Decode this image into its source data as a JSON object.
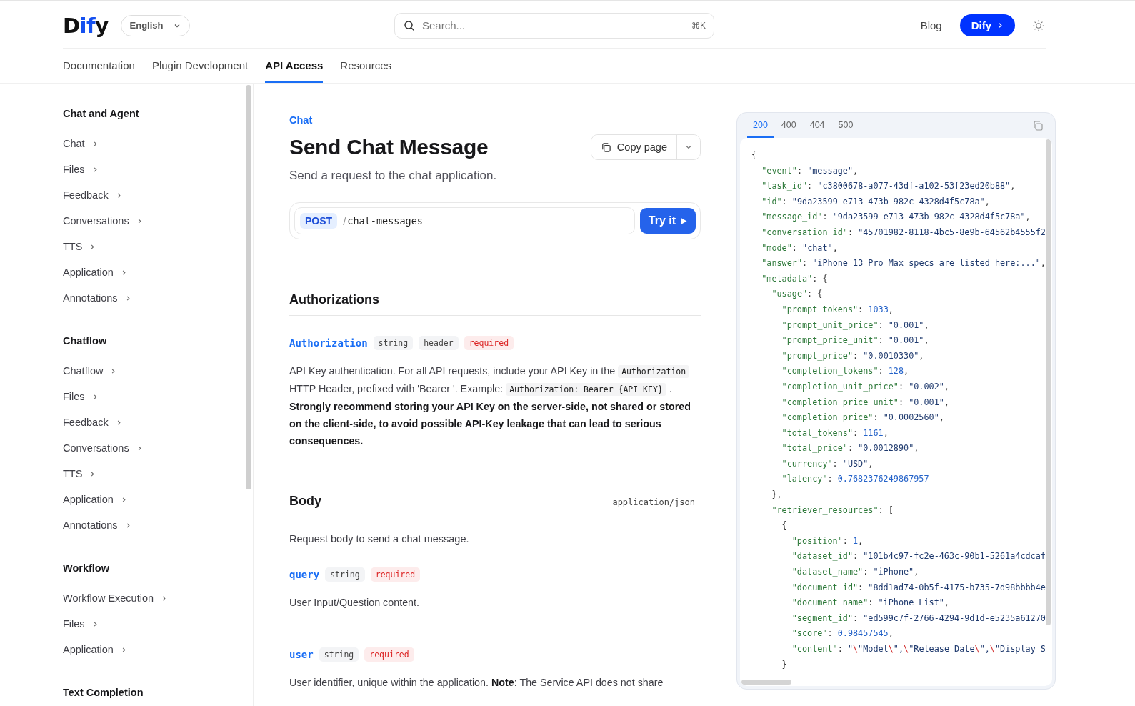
{
  "header": {
    "logo": {
      "parts": [
        {
          "text": "D",
          "accent": false
        },
        {
          "text": "if",
          "accent": true
        },
        {
          "text": "y",
          "accent": false
        }
      ]
    },
    "language": "English",
    "search": {
      "placeholder": "Search...",
      "shortcut": "⌘K"
    },
    "links": [
      "Blog"
    ],
    "cta": "Dify"
  },
  "nav_tabs": [
    {
      "label": "Documentation",
      "selected": false
    },
    {
      "label": "Plugin Development",
      "selected": false
    },
    {
      "label": "API Access",
      "selected": true
    },
    {
      "label": "Resources",
      "selected": false
    }
  ],
  "sidebar": {
    "groups": [
      {
        "title": "Chat and Agent",
        "items": [
          "Chat",
          "Files",
          "Feedback",
          "Conversations",
          "TTS",
          "Application",
          "Annotations"
        ]
      },
      {
        "title": "Chatflow",
        "items": [
          "Chatflow",
          "Files",
          "Feedback",
          "Conversations",
          "TTS",
          "Application",
          "Annotations"
        ]
      },
      {
        "title": "Workflow",
        "items": [
          "Workflow Execution",
          "Files",
          "Application"
        ]
      },
      {
        "title": "Text Completion"
      }
    ]
  },
  "page": {
    "breadcrumb": "Chat",
    "title": "Send Chat Message",
    "subtitle": "Send a request to the chat application.",
    "copy_button": "Copy page",
    "endpoint": {
      "method": "POST",
      "path_sep": "/",
      "path": "chat-messages",
      "try_button": "Try it"
    },
    "sections": [
      {
        "heading": "Authorizations",
        "params": [
          {
            "name": "Authorization",
            "tags": [
              {
                "text": "string",
                "kind": "type"
              },
              {
                "text": "header",
                "kind": "type"
              },
              {
                "text": "required",
                "kind": "required"
              }
            ],
            "description": [
              {
                "kind": "text",
                "text": "API Key authentication. For all API requests, include your API Key in the "
              },
              {
                "kind": "code",
                "text": "Authorization"
              },
              {
                "kind": "text",
                "text": " HTTP Header, prefixed with 'Bearer '. Example: "
              },
              {
                "kind": "code",
                "text": "Authorization: Bearer {API_KEY}"
              },
              {
                "kind": "text",
                "text": " . "
              },
              {
                "kind": "bold",
                "text": "Strongly recommend storing your API Key on the server-side, not shared or stored on the client-side, to avoid possible API-Key leakage that can lead to serious consequences."
              }
            ]
          }
        ]
      },
      {
        "heading": "Body",
        "content_type": "application/json",
        "intro": "Request body to send a chat message.",
        "params": [
          {
            "name": "query",
            "tags": [
              {
                "text": "string",
                "kind": "type"
              },
              {
                "text": "required",
                "kind": "required"
              }
            ],
            "description": [
              {
                "kind": "text",
                "text": "User Input/Question content."
              }
            ]
          },
          {
            "name": "user",
            "tags": [
              {
                "text": "string",
                "kind": "type"
              },
              {
                "text": "required",
                "kind": "required"
              }
            ],
            "description": [
              {
                "kind": "text",
                "text": "User identifier, unique within the application. "
              },
              {
                "kind": "bold",
                "text": "Note"
              },
              {
                "kind": "text",
                "text": ": The Service API does not share"
              }
            ]
          }
        ]
      }
    ]
  },
  "response": {
    "tabs": [
      {
        "label": "200",
        "selected": true
      },
      {
        "label": "400",
        "selected": false
      },
      {
        "label": "404",
        "selected": false
      },
      {
        "label": "500",
        "selected": false
      }
    ],
    "code": [
      {
        "tokens": [
          {
            "kind": "punct",
            "text": "{"
          }
        ],
        "children": [
          {
            "tokens": [
              {
                "kind": "key",
                "text": "\"event\""
              },
              {
                "kind": "punct",
                "text": ": "
              },
              {
                "kind": "string",
                "text": "\"message\""
              },
              {
                "kind": "punct",
                "text": ","
              }
            ]
          },
          {
            "tokens": [
              {
                "kind": "key",
                "text": "\"task_id\""
              },
              {
                "kind": "punct",
                "text": ": "
              },
              {
                "kind": "string",
                "text": "\"c3800678-a077-43df-a102-53f23ed20b88\""
              },
              {
                "kind": "punct",
                "text": ","
              }
            ]
          },
          {
            "tokens": [
              {
                "kind": "key",
                "text": "\"id\""
              },
              {
                "kind": "punct",
                "text": ": "
              },
              {
                "kind": "string",
                "text": "\"9da23599-e713-473b-982c-4328d4f5c78a\""
              },
              {
                "kind": "punct",
                "text": ","
              }
            ]
          },
          {
            "tokens": [
              {
                "kind": "key",
                "text": "\"message_id\""
              },
              {
                "kind": "punct",
                "text": ": "
              },
              {
                "kind": "string",
                "text": "\"9da23599-e713-473b-982c-4328d4f5c78a\""
              },
              {
                "kind": "punct",
                "text": ","
              }
            ]
          },
          {
            "tokens": [
              {
                "kind": "key",
                "text": "\"conversation_id\""
              },
              {
                "kind": "punct",
                "text": ": "
              },
              {
                "kind": "string",
                "text": "\"45701982-8118-4bc5-8e9b-64562b4555f2"
              }
            ]
          },
          {
            "tokens": [
              {
                "kind": "key",
                "text": "\"mode\""
              },
              {
                "kind": "punct",
                "text": ": "
              },
              {
                "kind": "string",
                "text": "\"chat\""
              },
              {
                "kind": "punct",
                "text": ","
              }
            ]
          },
          {
            "tokens": [
              {
                "kind": "key",
                "text": "\"answer\""
              },
              {
                "kind": "punct",
                "text": ": "
              },
              {
                "kind": "string",
                "text": "\"iPhone 13 Pro Max specs are listed here:...\""
              },
              {
                "kind": "punct",
                "text": ","
              }
            ]
          },
          {
            "tokens": [
              {
                "kind": "key",
                "text": "\"metadata\""
              },
              {
                "kind": "punct",
                "text": ": {"
              }
            ],
            "children": [
              {
                "tokens": [
                  {
                    "kind": "key",
                    "text": "\"usage\""
                  },
                  {
                    "kind": "punct",
                    "text": ": {"
                  }
                ],
                "children": [
                  {
                    "tokens": [
                      {
                        "kind": "key",
                        "text": "\"prompt_tokens\""
                      },
                      {
                        "kind": "punct",
                        "text": ": "
                      },
                      {
                        "kind": "number",
                        "text": "1033"
                      },
                      {
                        "kind": "punct",
                        "text": ","
                      }
                    ]
                  },
                  {
                    "tokens": [
                      {
                        "kind": "key",
                        "text": "\"prompt_unit_price\""
                      },
                      {
                        "kind": "punct",
                        "text": ": "
                      },
                      {
                        "kind": "string",
                        "text": "\"0.001\""
                      },
                      {
                        "kind": "punct",
                        "text": ","
                      }
                    ]
                  },
                  {
                    "tokens": [
                      {
                        "kind": "key",
                        "text": "\"prompt_price_unit\""
                      },
                      {
                        "kind": "punct",
                        "text": ": "
                      },
                      {
                        "kind": "string",
                        "text": "\"0.001\""
                      },
                      {
                        "kind": "punct",
                        "text": ","
                      }
                    ]
                  },
                  {
                    "tokens": [
                      {
                        "kind": "key",
                        "text": "\"prompt_price\""
                      },
                      {
                        "kind": "punct",
                        "text": ": "
                      },
                      {
                        "kind": "string",
                        "text": "\"0.0010330\""
                      },
                      {
                        "kind": "punct",
                        "text": ","
                      }
                    ]
                  },
                  {
                    "tokens": [
                      {
                        "kind": "key",
                        "text": "\"completion_tokens\""
                      },
                      {
                        "kind": "punct",
                        "text": ": "
                      },
                      {
                        "kind": "number",
                        "text": "128"
                      },
                      {
                        "kind": "punct",
                        "text": ","
                      }
                    ]
                  },
                  {
                    "tokens": [
                      {
                        "kind": "key",
                        "text": "\"completion_unit_price\""
                      },
                      {
                        "kind": "punct",
                        "text": ": "
                      },
                      {
                        "kind": "string",
                        "text": "\"0.002\""
                      },
                      {
                        "kind": "punct",
                        "text": ","
                      }
                    ]
                  },
                  {
                    "tokens": [
                      {
                        "kind": "key",
                        "text": "\"completion_price_unit\""
                      },
                      {
                        "kind": "punct",
                        "text": ": "
                      },
                      {
                        "kind": "string",
                        "text": "\"0.001\""
                      },
                      {
                        "kind": "punct",
                        "text": ","
                      }
                    ]
                  },
                  {
                    "tokens": [
                      {
                        "kind": "key",
                        "text": "\"completion_price\""
                      },
                      {
                        "kind": "punct",
                        "text": ": "
                      },
                      {
                        "kind": "string",
                        "text": "\"0.0002560\""
                      },
                      {
                        "kind": "punct",
                        "text": ","
                      }
                    ]
                  },
                  {
                    "tokens": [
                      {
                        "kind": "key",
                        "text": "\"total_tokens\""
                      },
                      {
                        "kind": "punct",
                        "text": ": "
                      },
                      {
                        "kind": "number",
                        "text": "1161"
                      },
                      {
                        "kind": "punct",
                        "text": ","
                      }
                    ]
                  },
                  {
                    "tokens": [
                      {
                        "kind": "key",
                        "text": "\"total_price\""
                      },
                      {
                        "kind": "punct",
                        "text": ": "
                      },
                      {
                        "kind": "string",
                        "text": "\"0.0012890\""
                      },
                      {
                        "kind": "punct",
                        "text": ","
                      }
                    ]
                  },
                  {
                    "tokens": [
                      {
                        "kind": "key",
                        "text": "\"currency\""
                      },
                      {
                        "kind": "punct",
                        "text": ": "
                      },
                      {
                        "kind": "string",
                        "text": "\"USD\""
                      },
                      {
                        "kind": "punct",
                        "text": ","
                      }
                    ]
                  },
                  {
                    "tokens": [
                      {
                        "kind": "key",
                        "text": "\"latency\""
                      },
                      {
                        "kind": "punct",
                        "text": ": "
                      },
                      {
                        "kind": "number",
                        "text": "0.7682376249867957"
                      }
                    ]
                  }
                ],
                "close": [
                  {
                    "kind": "punct",
                    "text": "},"
                  }
                ]
              },
              {
                "tokens": [
                  {
                    "kind": "key",
                    "text": "\"retriever_resources\""
                  },
                  {
                    "kind": "punct",
                    "text": ": ["
                  }
                ],
                "children": [
                  {
                    "tokens": [
                      {
                        "kind": "punct",
                        "text": "{"
                      }
                    ],
                    "children": [
                      {
                        "tokens": [
                          {
                            "kind": "key",
                            "text": "\"position\""
                          },
                          {
                            "kind": "punct",
                            "text": ": "
                          },
                          {
                            "kind": "number",
                            "text": "1"
                          },
                          {
                            "kind": "punct",
                            "text": ","
                          }
                        ]
                      },
                      {
                        "tokens": [
                          {
                            "kind": "key",
                            "text": "\"dataset_id\""
                          },
                          {
                            "kind": "punct",
                            "text": ": "
                          },
                          {
                            "kind": "string",
                            "text": "\"101b4c97-fc2e-463c-90b1-5261a4cdcaf"
                          }
                        ]
                      },
                      {
                        "tokens": [
                          {
                            "kind": "key",
                            "text": "\"dataset_name\""
                          },
                          {
                            "kind": "punct",
                            "text": ": "
                          },
                          {
                            "kind": "string",
                            "text": "\"iPhone\""
                          },
                          {
                            "kind": "punct",
                            "text": ","
                          }
                        ]
                      },
                      {
                        "tokens": [
                          {
                            "kind": "key",
                            "text": "\"document_id\""
                          },
                          {
                            "kind": "punct",
                            "text": ": "
                          },
                          {
                            "kind": "string",
                            "text": "\"8dd1ad74-0b5f-4175-b735-7d98bbbb4e"
                          }
                        ]
                      },
                      {
                        "tokens": [
                          {
                            "kind": "key",
                            "text": "\"document_name\""
                          },
                          {
                            "kind": "punct",
                            "text": ": "
                          },
                          {
                            "kind": "string",
                            "text": "\"iPhone List\""
                          },
                          {
                            "kind": "punct",
                            "text": ","
                          }
                        ]
                      },
                      {
                        "tokens": [
                          {
                            "kind": "key",
                            "text": "\"segment_id\""
                          },
                          {
                            "kind": "punct",
                            "text": ": "
                          },
                          {
                            "kind": "string",
                            "text": "\"ed599c7f-2766-4294-9d1d-e5235a61270"
                          }
                        ]
                      },
                      {
                        "tokens": [
                          {
                            "kind": "key",
                            "text": "\"score\""
                          },
                          {
                            "kind": "punct",
                            "text": ": "
                          },
                          {
                            "kind": "number",
                            "text": "0.98457545"
                          },
                          {
                            "kind": "punct",
                            "text": ","
                          }
                        ]
                      },
                      {
                        "tokens": [
                          {
                            "kind": "key",
                            "text": "\"content\""
                          },
                          {
                            "kind": "punct",
                            "text": ": "
                          },
                          {
                            "kind": "string",
                            "text": "\""
                          },
                          {
                            "kind": "escape",
                            "text": "\\"
                          },
                          {
                            "kind": "string",
                            "text": "\"Model"
                          },
                          {
                            "kind": "escape",
                            "text": "\\"
                          },
                          {
                            "kind": "string",
                            "text": "\","
                          },
                          {
                            "kind": "escape",
                            "text": "\\"
                          },
                          {
                            "kind": "string",
                            "text": "\"Release Date"
                          },
                          {
                            "kind": "escape",
                            "text": "\\"
                          },
                          {
                            "kind": "string",
                            "text": "\","
                          },
                          {
                            "kind": "escape",
                            "text": "\\"
                          },
                          {
                            "kind": "string",
                            "text": "\"Display S"
                          }
                        ]
                      }
                    ],
                    "close": [
                      {
                        "kind": "punct",
                        "text": "}"
                      }
                    ]
                  }
                ]
              }
            ]
          }
        ]
      }
    ]
  }
}
